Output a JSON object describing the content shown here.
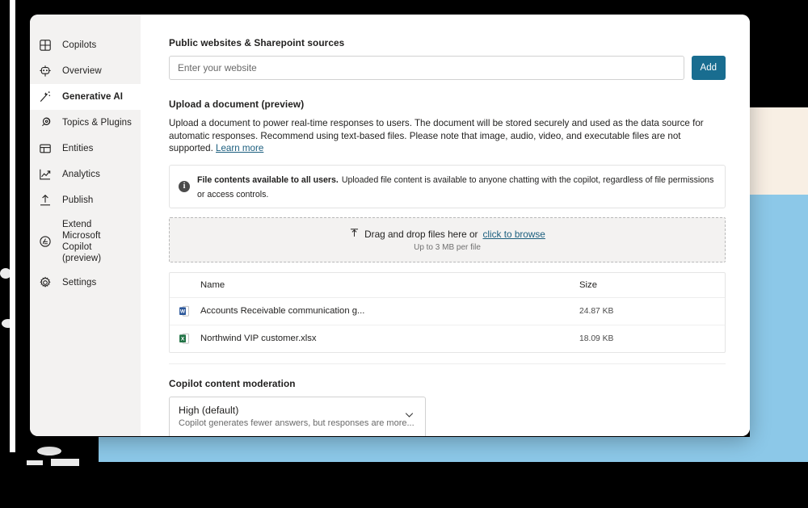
{
  "colors": {
    "accent_button": "#196d90",
    "link": "#1b5e7e",
    "sidebar_bg": "#f3f2f1",
    "deco_blue": "#8cc8e8",
    "deco_cream": "#f8efe4",
    "word_icon": "#2b579a",
    "excel_icon": "#217346"
  },
  "sidebar": {
    "items": [
      {
        "label": "Copilots",
        "icon": "grid-icon",
        "selected": false
      },
      {
        "label": "Overview",
        "icon": "robot-icon",
        "selected": false
      },
      {
        "label": "Generative AI",
        "icon": "magic-wand-icon",
        "selected": true
      },
      {
        "label": "Topics & Plugins",
        "icon": "plugins-icon",
        "selected": false
      },
      {
        "label": "Entities",
        "icon": "entities-icon",
        "selected": false
      },
      {
        "label": "Analytics",
        "icon": "chart-line-icon",
        "selected": false
      },
      {
        "label": "Publish",
        "icon": "upload-icon",
        "selected": false
      },
      {
        "label": "Extend Microsoft Copilot (preview)",
        "icon": "extend-icon",
        "selected": false
      },
      {
        "label": "Settings",
        "icon": "gear-icon",
        "selected": false
      }
    ]
  },
  "main": {
    "websites": {
      "title": "Public websites & Sharepoint sources",
      "input_placeholder": "Enter your website",
      "input_value": "",
      "add_label": "Add"
    },
    "upload": {
      "title": "Upload a document (preview)",
      "description": "Upload a document to power real-time responses to users. The document will be stored securely and used as the data source for automatic responses. Recommend using text-based files. Please note that image, audio, video, and executable files are not supported. ",
      "learn_more_label": "Learn more",
      "banner": {
        "icon": "info-icon",
        "strong": "File contents available to all users.",
        "text": "Uploaded file content is available to anyone chatting with the copilot, regardless of file permissions or access controls."
      },
      "dropzone": {
        "icon": "upload-arrow-icon",
        "prefix": "Drag and drop files here or",
        "browse_label": "click to browse",
        "hint": "Up to 3 MB per file"
      }
    },
    "file_table": {
      "columns": [
        "Name",
        "Size"
      ],
      "rows": [
        {
          "icon": "word-file-icon",
          "name": "Accounts Receivable communication g...",
          "size": "24.87 KB"
        },
        {
          "icon": "excel-file-icon",
          "name": "Northwind VIP customer.xlsx",
          "size": "18.09 KB"
        }
      ]
    },
    "moderation": {
      "title": "Copilot content moderation",
      "selected_value": "High (default)",
      "selected_description": "Copilot generates fewer answers, but responses are more...",
      "chevron": "chevron-down-icon"
    }
  }
}
